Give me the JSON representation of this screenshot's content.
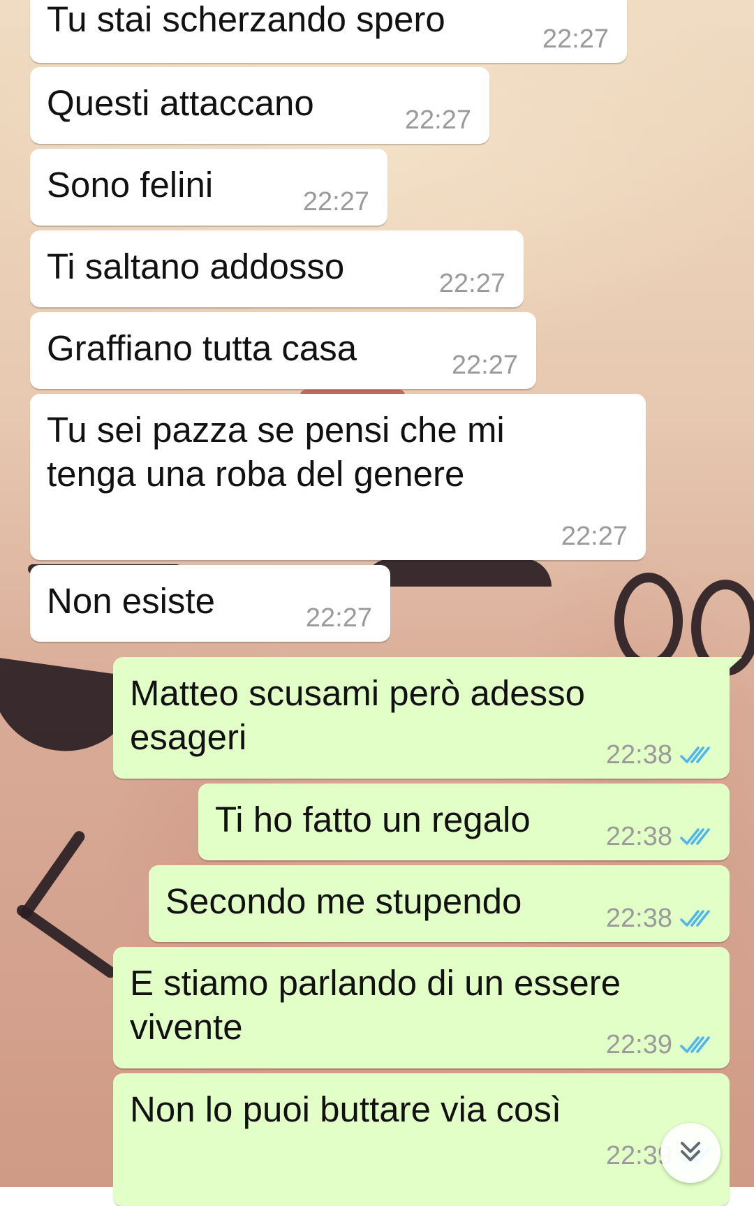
{
  "messages": [
    {
      "direction": "in",
      "text": "Tu stai scherzando spero",
      "time": "22:27"
    },
    {
      "direction": "in",
      "text": "Questi attaccano",
      "time": "22:27"
    },
    {
      "direction": "in",
      "text": "Sono felini",
      "time": "22:27"
    },
    {
      "direction": "in",
      "text": "Ti saltano addosso",
      "time": "22:27"
    },
    {
      "direction": "in",
      "text": "Graffiano tutta casa",
      "time": "22:27"
    },
    {
      "direction": "in",
      "text": "Tu sei pazza se pensi che mi\ntenga una roba del genere",
      "time": "22:27"
    },
    {
      "direction": "in",
      "text": "Non esiste",
      "time": "22:27"
    },
    {
      "direction": "out",
      "text": "Matteo scusami però adesso\nesageri",
      "time": "22:38",
      "status": "read"
    },
    {
      "direction": "out",
      "text": "Ti ho fatto un regalo",
      "time": "22:38",
      "status": "read"
    },
    {
      "direction": "out",
      "text": "Secondo me stupendo",
      "time": "22:38",
      "status": "read"
    },
    {
      "direction": "out",
      "text": "E stiamo parlando di un essere\nvivente",
      "time": "22:39",
      "status": "read"
    },
    {
      "direction": "out",
      "text": "Non lo puoi buttare via così",
      "time": "22:39",
      "status": "read"
    }
  ],
  "icons": {
    "read_receipt": "double-check-icon",
    "scroll_down": "chevron-double-down-icon"
  },
  "colors": {
    "incoming_bubble": "#ffffff",
    "outgoing_bubble": "#e2ffc8",
    "timestamp": "#9a9a9a",
    "read_tick": "#4fb6ec"
  }
}
